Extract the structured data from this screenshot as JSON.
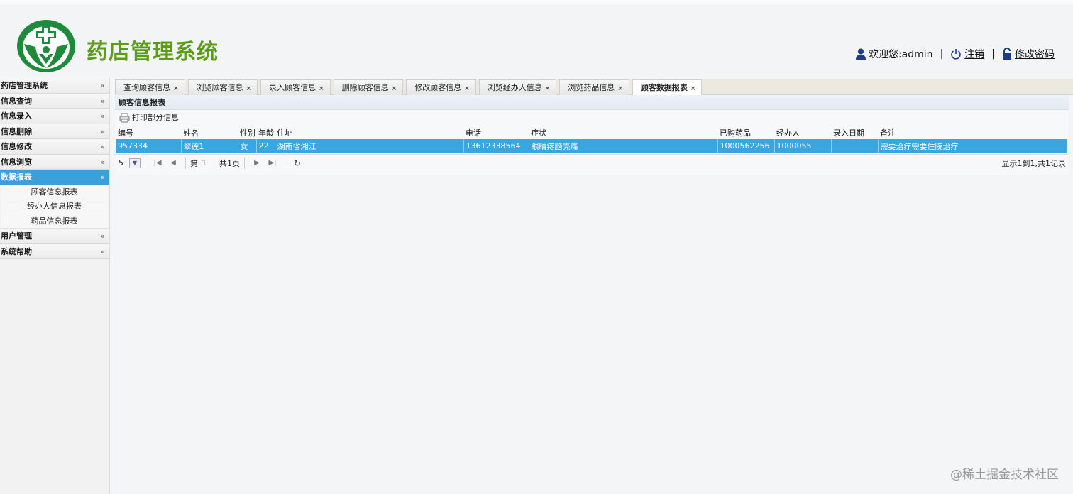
{
  "header": {
    "title": "药店管理系统",
    "welcome": "欢迎您:admin",
    "logout": "注销",
    "change_password": "修改密码"
  },
  "sidebar": {
    "items": [
      {
        "label": "药店管理系统",
        "arrow": "«"
      },
      {
        "label": "信息查询",
        "arrow": "»"
      },
      {
        "label": "信息录入",
        "arrow": "»"
      },
      {
        "label": "信息删除",
        "arrow": "»"
      },
      {
        "label": "信息修改",
        "arrow": "»"
      },
      {
        "label": "信息浏览",
        "arrow": "»"
      },
      {
        "label": "数据报表",
        "arrow": "«"
      },
      {
        "label": "用户管理",
        "arrow": "»"
      },
      {
        "label": "系统帮助",
        "arrow": "»"
      }
    ],
    "sub_items": [
      "顾客信息报表",
      "经办人信息报表",
      "药品信息报表"
    ]
  },
  "tabs": [
    {
      "label": "查询顾客信息"
    },
    {
      "label": "浏览顾客信息"
    },
    {
      "label": "录入顾客信息"
    },
    {
      "label": "删除顾客信息"
    },
    {
      "label": "修改顾客信息"
    },
    {
      "label": "浏览经办人信息"
    },
    {
      "label": "浏览药品信息"
    },
    {
      "label": "顾客数据报表"
    }
  ],
  "tab_close": "×",
  "panel": {
    "title": "顾客信息报表",
    "print_label": "打印部分信息"
  },
  "table": {
    "headers": [
      "编号",
      "姓名",
      "性别",
      "年龄",
      "住址",
      "电话",
      "症状",
      "已购药品",
      "经办人",
      "录入日期",
      "备注"
    ],
    "rows": [
      [
        "957334",
        "翠莲1",
        "女",
        "22",
        "湖南省湘江",
        "13612338564",
        "眼睛疼脑壳痛",
        "1000562256",
        "1000055",
        "",
        "需要治疗需要住院治疗"
      ]
    ]
  },
  "pager": {
    "page_size": "5",
    "page_prefix": "第",
    "page_value": "1",
    "total_pages": "共1页",
    "summary": "显示1到1,共1记录"
  },
  "watermark": "@稀土掘金技术社区",
  "accent_color": "#3aa6df",
  "brand_color": "#5b9d14"
}
